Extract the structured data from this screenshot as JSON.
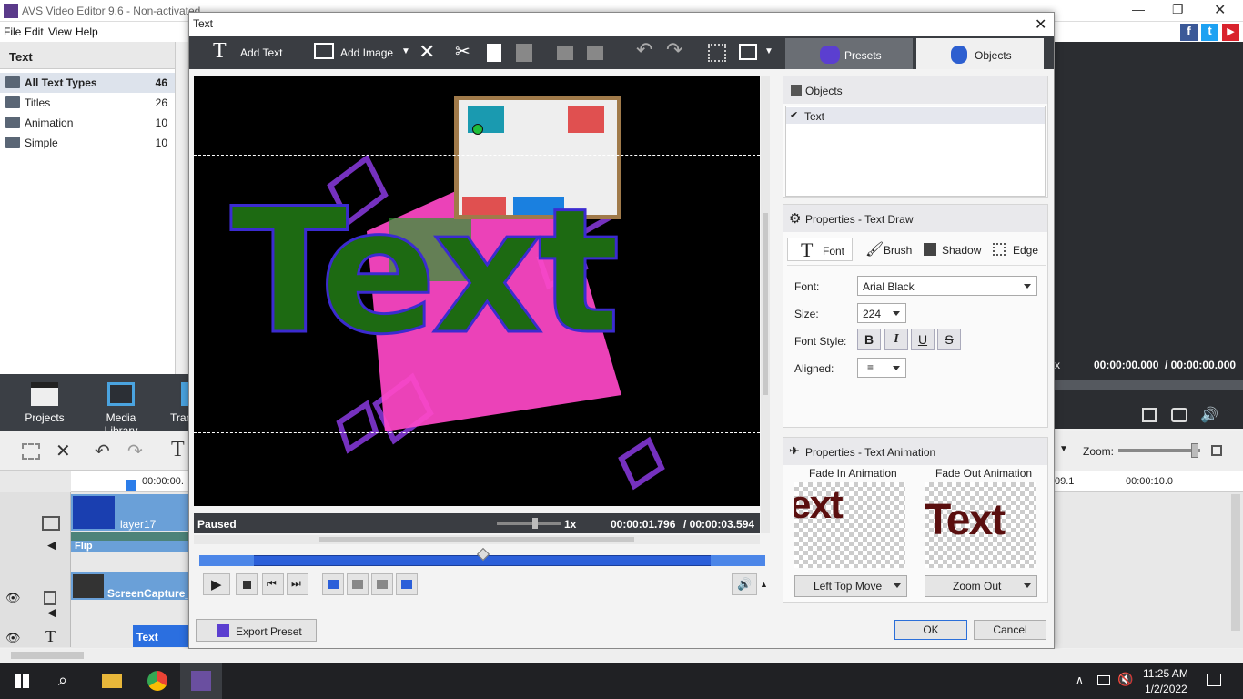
{
  "app": {
    "title": "AVS Video Editor 9.6 - Non-activated",
    "menu": [
      "File",
      "Edit",
      "View",
      "Help"
    ],
    "left_panel": {
      "header": "Text",
      "items": [
        {
          "label": "All Text Types",
          "count": "46"
        },
        {
          "label": "Titles",
          "count": "26"
        },
        {
          "label": "Animation",
          "count": "10"
        },
        {
          "label": "Simple",
          "count": "10"
        }
      ]
    },
    "bottom_tabs": [
      "Projects",
      "Media Library",
      "Tran"
    ],
    "right_panel": {
      "time": "00:00:00.000",
      "duration": "/ 00:00:00.000",
      "x_label": "x"
    },
    "timeline": {
      "ruler_time": "00:00:00.",
      "ruler_right_1": "09.1",
      "ruler_right_2": "00:00:10.0",
      "zoom_label": "Zoom:",
      "tracks": [
        "layer17",
        "Flip",
        "ScreenCapture_",
        "Text"
      ]
    }
  },
  "dialog": {
    "title": "Text",
    "toolbar": {
      "add_text": "Add Text",
      "add_image": "Add Image"
    },
    "tabs": {
      "presets": "Presets",
      "objects": "Objects"
    },
    "video_text": "Text",
    "status": "Paused",
    "speed": "1x",
    "time_current": "00:00:01.796",
    "time_total": "/ 00:00:03.594",
    "objects_section": {
      "header": "Objects",
      "items": [
        "Text"
      ]
    },
    "properties": {
      "header": "Properties - Text Draw",
      "tabs": [
        "Font",
        "Brush",
        "Shadow",
        "Edge"
      ],
      "font_label": "Font:",
      "font_value": "Arial Black",
      "size_label": "Size:",
      "size_value": "224",
      "style_label": "Font Style:",
      "style_buttons": [
        "B",
        "I",
        "U",
        "S"
      ],
      "aligned_label": "Aligned:"
    },
    "animation": {
      "header": "Properties - Text Animation",
      "fade_in_label": "Fade In Animation",
      "fade_out_label": "Fade Out Animation",
      "fade_in_preview": "ext",
      "fade_out_preview": "Text",
      "fade_in_value": "Left Top Move",
      "fade_out_value": "Zoom Out"
    },
    "buttons": {
      "export_preset": "Export Preset",
      "ok": "OK",
      "cancel": "Cancel"
    }
  },
  "taskbar": {
    "time": "11:25 AM",
    "date": "1/2/2022"
  },
  "colors": {
    "accent": "#2b5fd9",
    "text_green": "#1b6b12",
    "text_green_bright": "#18d018",
    "pink": "#ff4fc0"
  }
}
